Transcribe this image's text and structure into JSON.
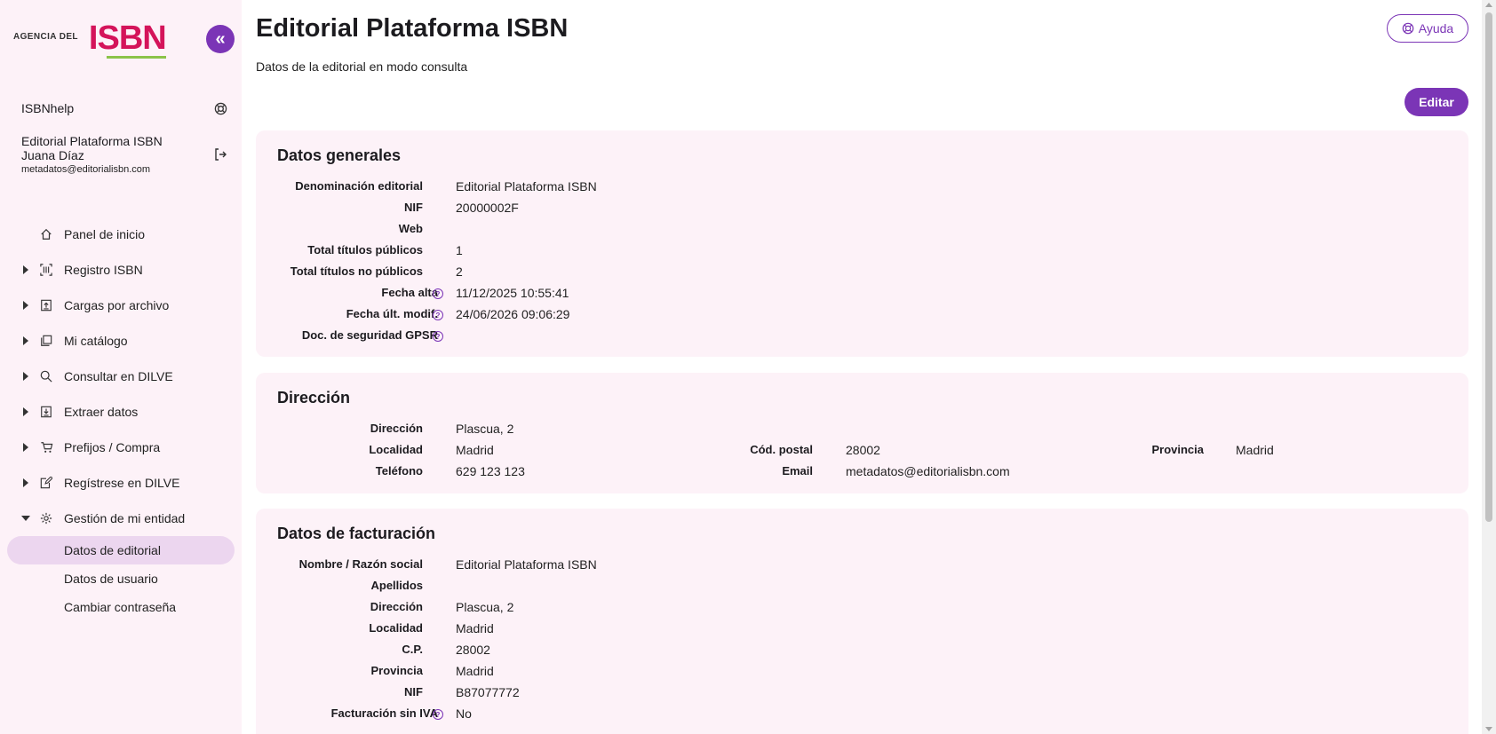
{
  "brand": {
    "small": "AGENCIA DEL",
    "big": "ISBN"
  },
  "sidebar": {
    "help_label": "ISBNhelp",
    "user": {
      "org": "Editorial Plataforma ISBN",
      "name": "Juana Díaz",
      "email": "metadatos@editorialisbn.com"
    },
    "items": [
      {
        "label": "Panel de inicio",
        "icon": "home-icon"
      },
      {
        "label": "Registro ISBN",
        "icon": "barcode-icon"
      },
      {
        "label": "Cargas por archivo",
        "icon": "upload-file-icon"
      },
      {
        "label": "Mi catálogo",
        "icon": "catalog-icon"
      },
      {
        "label": "Consultar en DILVE",
        "icon": "search-icon"
      },
      {
        "label": "Extraer datos",
        "icon": "download-file-icon"
      },
      {
        "label": "Prefijos / Compra",
        "icon": "cart-icon"
      },
      {
        "label": "Regístrese en DILVE",
        "icon": "register-icon"
      },
      {
        "label": "Gestión de mi entidad",
        "icon": "gear-icon"
      }
    ],
    "subitems": [
      {
        "label": "Datos de editorial",
        "active": true
      },
      {
        "label": "Datos de usuario",
        "active": false
      },
      {
        "label": "Cambiar contraseña",
        "active": false
      }
    ]
  },
  "header": {
    "title": "Editorial Plataforma ISBN",
    "subtitle": "Datos de la editorial en modo consulta",
    "help_button": "Ayuda",
    "edit_button": "Editar"
  },
  "general": {
    "title": "Datos generales",
    "fields": [
      {
        "label": "Denominación editorial",
        "value": "Editorial Plataforma ISBN",
        "help": false
      },
      {
        "label": "NIF",
        "value": "20000002F",
        "help": false
      },
      {
        "label": "Web",
        "value": "",
        "help": false
      },
      {
        "label": "Total títulos públicos",
        "value": "1",
        "help": false
      },
      {
        "label": "Total títulos no públicos",
        "value": "2",
        "help": false
      },
      {
        "label": "Fecha alta",
        "value": "11/12/2025 10:55:41",
        "help": true
      },
      {
        "label": "Fecha últ. modif.",
        "value": "24/06/2026 09:06:29",
        "help": true
      },
      {
        "label": "Doc. de seguridad GPSR",
        "value": "",
        "help": true
      }
    ]
  },
  "address": {
    "title": "Dirección",
    "direccion_label": "Dirección",
    "direccion": "Plascua, 2",
    "localidad_label": "Localidad",
    "localidad": "Madrid",
    "cp_label": "Cód. postal",
    "cp": "28002",
    "provincia_label": "Provincia",
    "provincia": "Madrid",
    "telefono_label": "Teléfono",
    "telefono": "629 123 123",
    "email_label": "Email",
    "email": "metadatos@editorialisbn.com"
  },
  "billing": {
    "title": "Datos de facturación",
    "fields": [
      {
        "label": "Nombre / Razón social",
        "value": "Editorial Plataforma ISBN",
        "help": false
      },
      {
        "label": "Apellidos",
        "value": "",
        "help": false
      },
      {
        "label": "Dirección",
        "value": "Plascua, 2",
        "help": false
      },
      {
        "label": "Localidad",
        "value": "Madrid",
        "help": false
      },
      {
        "label": "C.P.",
        "value": "28002",
        "help": false
      },
      {
        "label": "Provincia",
        "value": "Madrid",
        "help": false
      },
      {
        "label": "NIF",
        "value": "B87077772",
        "help": false
      },
      {
        "label": "Facturación sin IVA",
        "value": "No",
        "help": true
      }
    ]
  },
  "colors": {
    "accent": "#7b35b6",
    "card_bg": "#fdf2f8",
    "brand": "#d4145a"
  }
}
